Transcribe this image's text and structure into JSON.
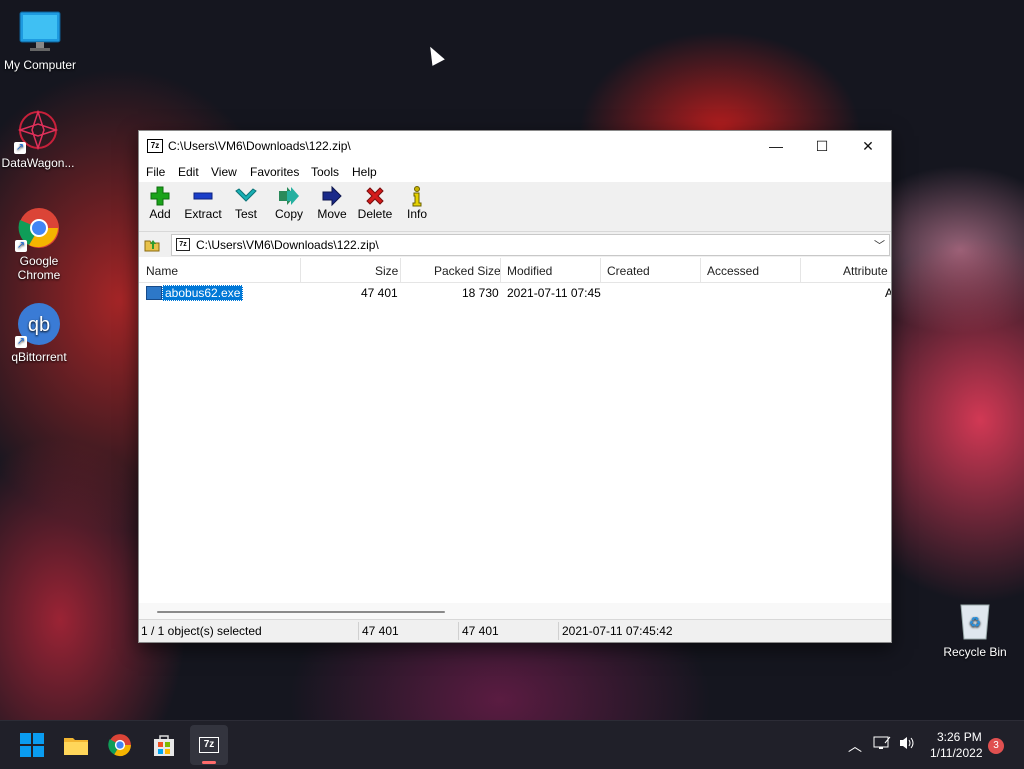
{
  "desktop": {
    "icons": [
      {
        "label": "My Computer"
      },
      {
        "label": "DataWagon..."
      },
      {
        "label": "Google Chrome"
      },
      {
        "label": "qBittorrent"
      },
      {
        "label": "Recycle Bin"
      }
    ]
  },
  "window": {
    "title": "C:\\Users\\VM6\\Downloads\\122.zip\\",
    "app_icon": "7z",
    "menu": [
      "File",
      "Edit",
      "View",
      "Favorites",
      "Tools",
      "Help"
    ],
    "toolbar": [
      {
        "label": "Add",
        "icon": "plus-icon",
        "color": "#1aa31a"
      },
      {
        "label": "Extract",
        "icon": "minus-icon",
        "color": "#1a3ec9"
      },
      {
        "label": "Test",
        "icon": "check-icon",
        "color": "#19b0b5"
      },
      {
        "label": "Copy",
        "icon": "double-arrow-icon",
        "color": "#1e9b7a"
      },
      {
        "label": "Move",
        "icon": "arrow-right-icon",
        "color": "#1a2a8a"
      },
      {
        "label": "Delete",
        "icon": "x-icon",
        "color": "#d41c1c"
      },
      {
        "label": "Info",
        "icon": "info-icon",
        "color": "#c8b400"
      }
    ],
    "address": "C:\\Users\\VM6\\Downloads\\122.zip\\",
    "columns": [
      "Name",
      "Size",
      "Packed Size",
      "Modified",
      "Created",
      "Accessed",
      "Attribute"
    ],
    "rows": [
      {
        "name": "abobus62.exe",
        "size": "47 401",
        "packed": "18 730",
        "modified": "2021-07-11 07:45",
        "attr": "A"
      }
    ],
    "status": {
      "selected": "1 / 1 object(s) selected",
      "size": "47 401",
      "packed": "47 401",
      "modified": "2021-07-11 07:45:42"
    }
  },
  "taskbar": {
    "time": "3:26 PM",
    "date": "1/11/2022",
    "notifications": "3",
    "app_7z_label": "7z"
  },
  "colors": {
    "selection": "#0078d7",
    "taskbar": "#202029"
  }
}
